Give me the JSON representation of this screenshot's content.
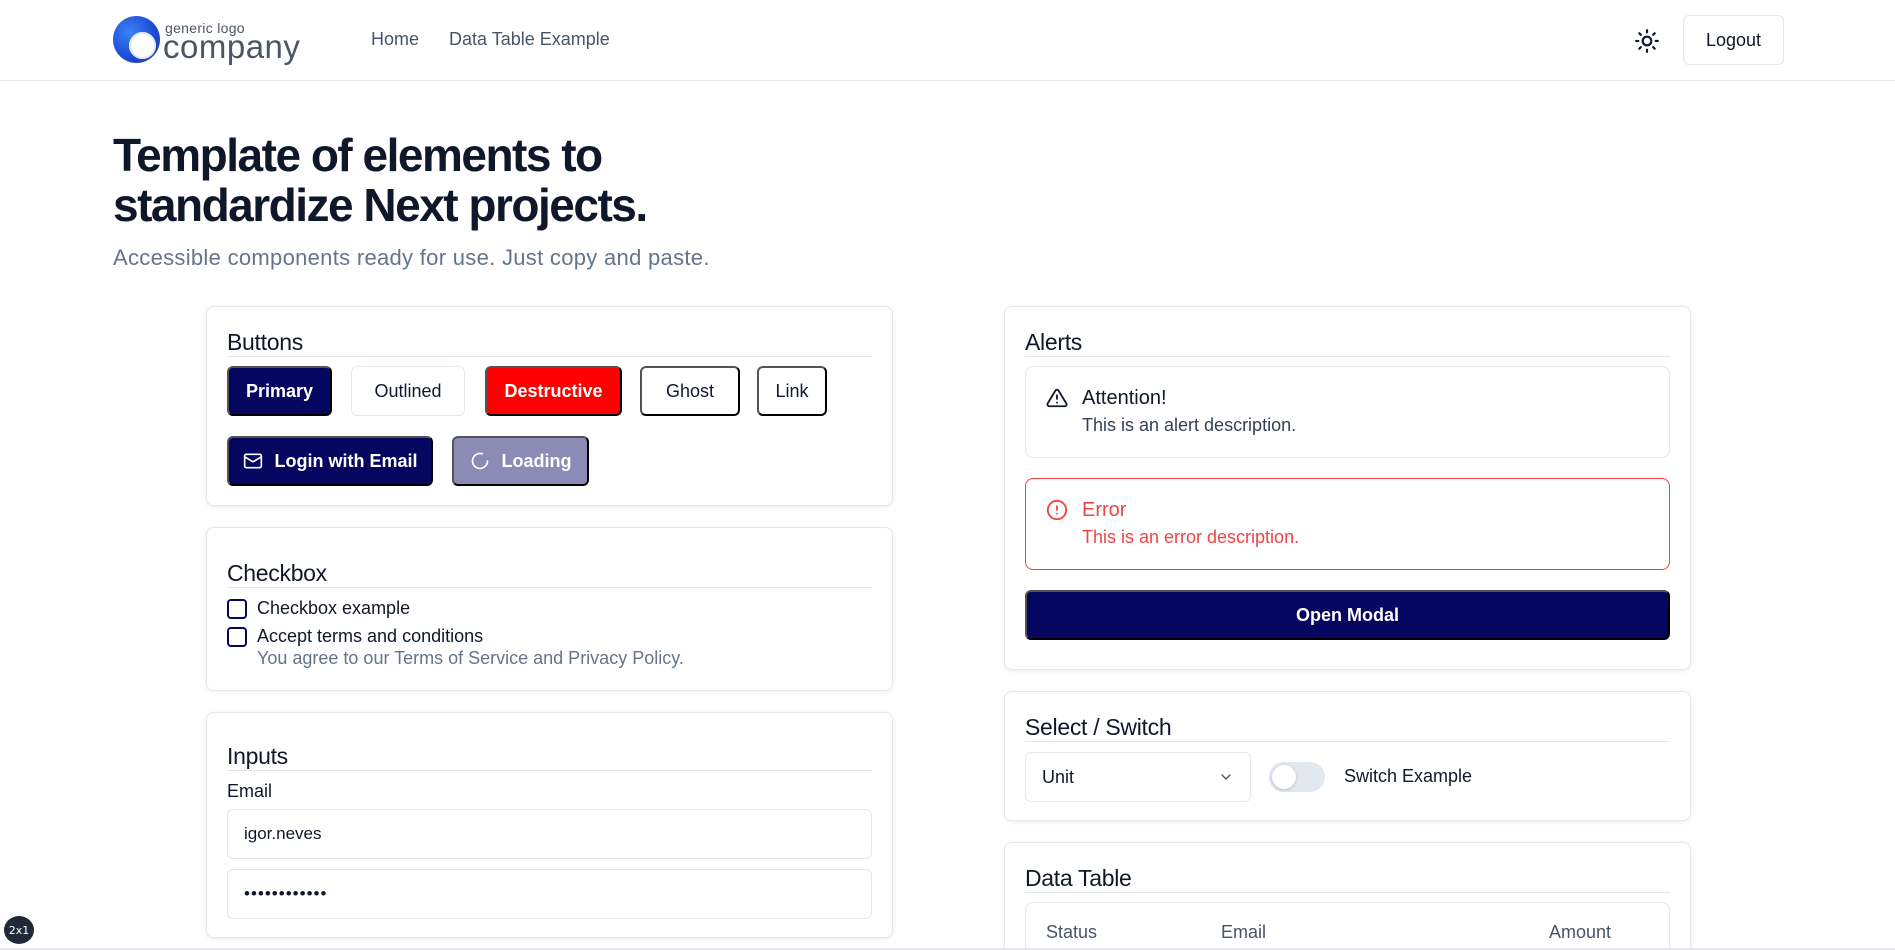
{
  "header": {
    "logo_small": "generic logo",
    "logo_big": "company",
    "nav": [
      "Home",
      "Data Table Example"
    ],
    "logout_label": "Logout",
    "theme_icon": "sun-icon"
  },
  "hero": {
    "title_line1": "Template of elements to",
    "title_line2": "standardize Next projects.",
    "subtitle": "Accessible components ready for use. Just copy and paste."
  },
  "buttons_card": {
    "title": "Buttons",
    "primary": "Primary",
    "outlined": "Outlined",
    "destructive": "Destructive",
    "ghost": "Ghost",
    "link": "Link",
    "login": "Login with Email",
    "loading": "Loading"
  },
  "checkbox_card": {
    "title": "Checkbox",
    "example_label": "Checkbox example",
    "terms_label": "Accept terms and conditions",
    "terms_desc": "You agree to our Terms of Service and Privacy Policy."
  },
  "inputs_card": {
    "title": "Inputs",
    "email_label": "Email",
    "email_value": "igor.neves",
    "password_value": "••••••••••••"
  },
  "alerts_card": {
    "title": "Alerts",
    "attention_title": "Attention!",
    "attention_desc": "This is an alert description.",
    "error_title": "Error",
    "error_desc": "This is an error description.",
    "open_modal": "Open Modal"
  },
  "select_card": {
    "title": "Select / Switch",
    "select_value": "Unit",
    "switch_label": "Switch Example",
    "switch_on": false
  },
  "table_card": {
    "title": "Data Table",
    "columns": [
      "Status",
      "Email",
      "Amount"
    ]
  },
  "badge": "2x1",
  "colors": {
    "primary": "#050660",
    "destructive": "#ff0000",
    "error": "#ef4444",
    "muted": "#64748b"
  }
}
